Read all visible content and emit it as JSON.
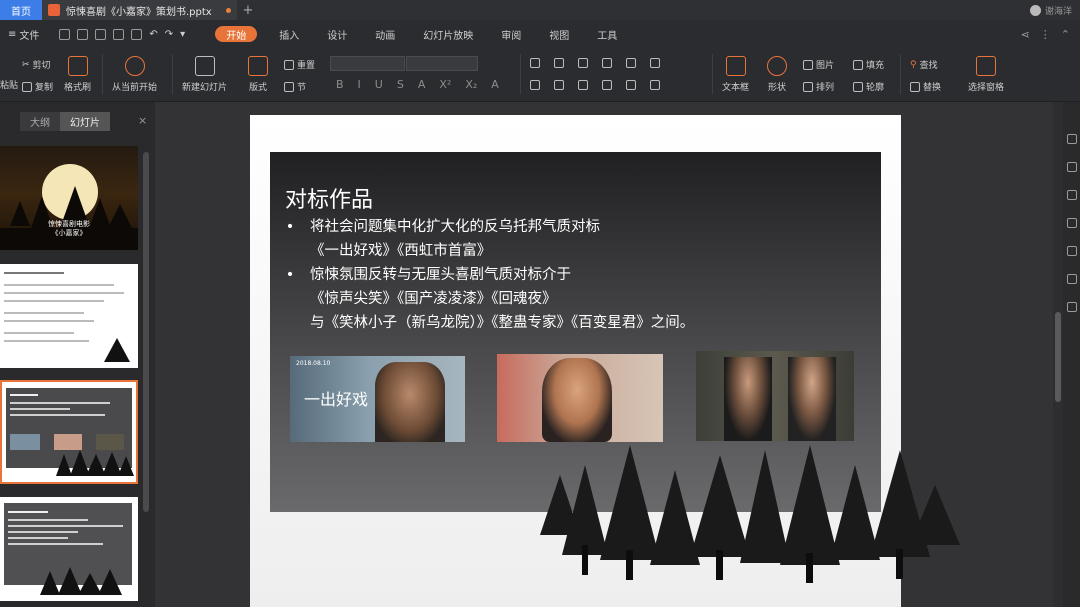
{
  "titlebar": {
    "home_tab": "首页",
    "doc_tab": "惊悚喜剧《小嘉家》策划书.pptx",
    "add_tab": "+",
    "user": "谢海洋"
  },
  "menubar": {
    "file": "文件",
    "tabs": [
      "开始",
      "插入",
      "设计",
      "动画",
      "幻灯片放映",
      "审阅",
      "视图",
      "工具"
    ],
    "active_tab": "开始"
  },
  "ribbon": {
    "cut": "剪切",
    "copy": "复制",
    "format_painter": "格式刷",
    "paste": "粘贴",
    "play_from_start": "从当前开始",
    "new_slide": "新建幻灯片",
    "layout": "版式",
    "reset": "重置",
    "section": "节",
    "text_box": "文本框",
    "shape": "形状",
    "picture": "图片",
    "arrange": "排列",
    "fill": "填充",
    "outline": "轮廓",
    "find": "查找",
    "replace": "替换",
    "select_pane": "选择窗格",
    "format_buttons": [
      "B",
      "I",
      "U",
      "S",
      "A",
      "X²",
      "X₂",
      "A"
    ]
  },
  "left_panel": {
    "tab_outline": "大纲",
    "tab_slides": "幻灯片",
    "close": "×",
    "thumb1_title_line1": "惊悚喜剧电影",
    "thumb1_title_line2": "《小嘉家》"
  },
  "slide": {
    "title": "对标作品",
    "bullet1": "将社会问题集中化扩大化的反乌托邦气质对标",
    "bullet1_cont": "《一出好戏》《西虹市首富》",
    "bullet2": "惊悚氛围反转与无厘头喜剧气质对标介于",
    "bullet2_cont1": "《惊声尖笑》《国产凌凌漆》《回魂夜》",
    "bullet2_cont2": "与《笑林小子（新乌龙院）》《整蛊专家》《百变星君》之间。",
    "photo1_brand": "一出好戏",
    "photo1_date": "2018.08.10"
  },
  "colors": {
    "accent": "#e8743a",
    "home_tab": "#3d7de8"
  }
}
